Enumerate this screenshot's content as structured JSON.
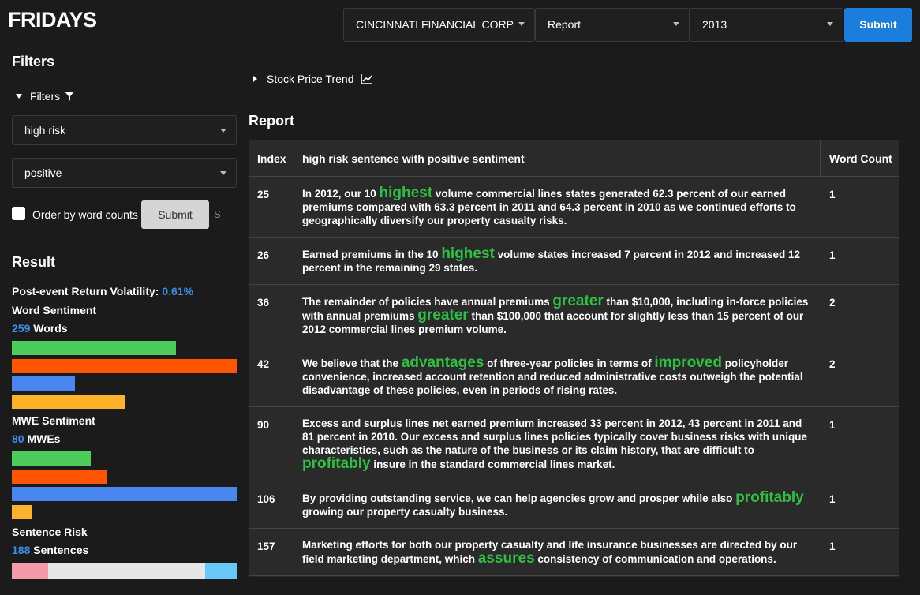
{
  "app": {
    "title": "FRIDAYS"
  },
  "toolbar": {
    "company": "CINCINNATI FINANCIAL CORP",
    "view": "Report",
    "year": "2013",
    "submit_label": "Submit"
  },
  "sidebar": {
    "heading": "Filters",
    "filters_toggle": "Filters",
    "risk_select": "high risk",
    "sentiment_select": "positive",
    "order_label": "Order by word counts",
    "submit_label": "Submit",
    "trailing_char": "S"
  },
  "result": {
    "heading": "Result",
    "volatility_label": "Post-event Return Volatility:",
    "volatility_value": "0.61%",
    "word_sentiment_label": "Word Sentiment",
    "word_count": "259",
    "word_unit": " Words",
    "word_bars": [
      0.73,
      1.0,
      0.28,
      0.5
    ],
    "mwe_sentiment_label": "MWE Sentiment",
    "mwe_count": "80",
    "mwe_unit": " MWEs",
    "mwe_bars": [
      0.35,
      0.42,
      1.0,
      0.09
    ],
    "sentence_risk_label": "Sentence Risk",
    "sentence_count": "188",
    "sentence_unit": " Sentences",
    "risk_split": [
      0.16,
      0.7,
      0.14
    ],
    "colors": {
      "green": "#4ccd5b",
      "orange": "#ff5400",
      "blue": "#4a86f0",
      "yellow": "#fdb22a",
      "pink": "#f59aaa",
      "light_gray": "#e6e6e6",
      "light_blue": "#66c8f6"
    }
  },
  "main": {
    "trend_label": "Stock Price Trend",
    "report_heading": "Report",
    "columns": [
      "Index",
      "high risk sentence with positive sentiment",
      "Word Count"
    ],
    "rows": [
      {
        "index": "25",
        "word_count": "1",
        "parts": [
          {
            "t": "In 2012, our 10 "
          },
          {
            "t": "highest",
            "hl": true
          },
          {
            "t": " volume commercial lines states generated 62.3 percent of our earned premiums compared with 63.3 percent in 2011 and 64.3 percent in 2010 as we continued efforts to geographically diversify our property casualty risks."
          }
        ]
      },
      {
        "index": "26",
        "word_count": "1",
        "parts": [
          {
            "t": "Earned premiums in the 10 "
          },
          {
            "t": "highest",
            "hl": true
          },
          {
            "t": " volume states increased 7 percent in 2012 and increased 12 percent in the remaining 29 states."
          }
        ]
      },
      {
        "index": "36",
        "word_count": "2",
        "parts": [
          {
            "t": "The remainder of policies have annual premiums "
          },
          {
            "t": "greater",
            "hl": true
          },
          {
            "t": " than $10,000, including in-force policies with annual premiums "
          },
          {
            "t": "greater",
            "hl": true
          },
          {
            "t": " than $100,000 that account for slightly less than 15 percent of our 2012 commercial lines premium volume."
          }
        ]
      },
      {
        "index": "42",
        "word_count": "2",
        "parts": [
          {
            "t": "We believe that the "
          },
          {
            "t": "advantages",
            "hl": true
          },
          {
            "t": " of three-year policies in terms of "
          },
          {
            "t": "improved",
            "hl": true
          },
          {
            "t": " policyholder convenience, increased account retention and reduced administrative costs outweigh the potential disadvantage of these policies, even in periods of rising rates."
          }
        ]
      },
      {
        "index": "90",
        "word_count": "1",
        "parts": [
          {
            "t": "Excess and surplus lines net earned premium increased 33 percent in 2012, 43 percent in 2011 and 81 percent in 2010. Our excess and surplus lines policies typically cover business risks with unique characteristics, such as the nature of the business or its claim history, that are difficult to "
          },
          {
            "t": "profitably",
            "hl": true
          },
          {
            "t": " insure in the standard commercial lines market."
          }
        ]
      },
      {
        "index": "106",
        "word_count": "1",
        "parts": [
          {
            "t": "By providing outstanding service, we can help agencies grow and prosper while also "
          },
          {
            "t": "profitably",
            "hl": true
          },
          {
            "t": " growing our property casualty business."
          }
        ]
      },
      {
        "index": "157",
        "word_count": "1",
        "parts": [
          {
            "t": "Marketing efforts for both our property casualty and life insurance businesses are directed by our field marketing department, which "
          },
          {
            "t": "assures",
            "hl": true
          },
          {
            "t": " consistency of communication and operations."
          }
        ]
      }
    ]
  }
}
